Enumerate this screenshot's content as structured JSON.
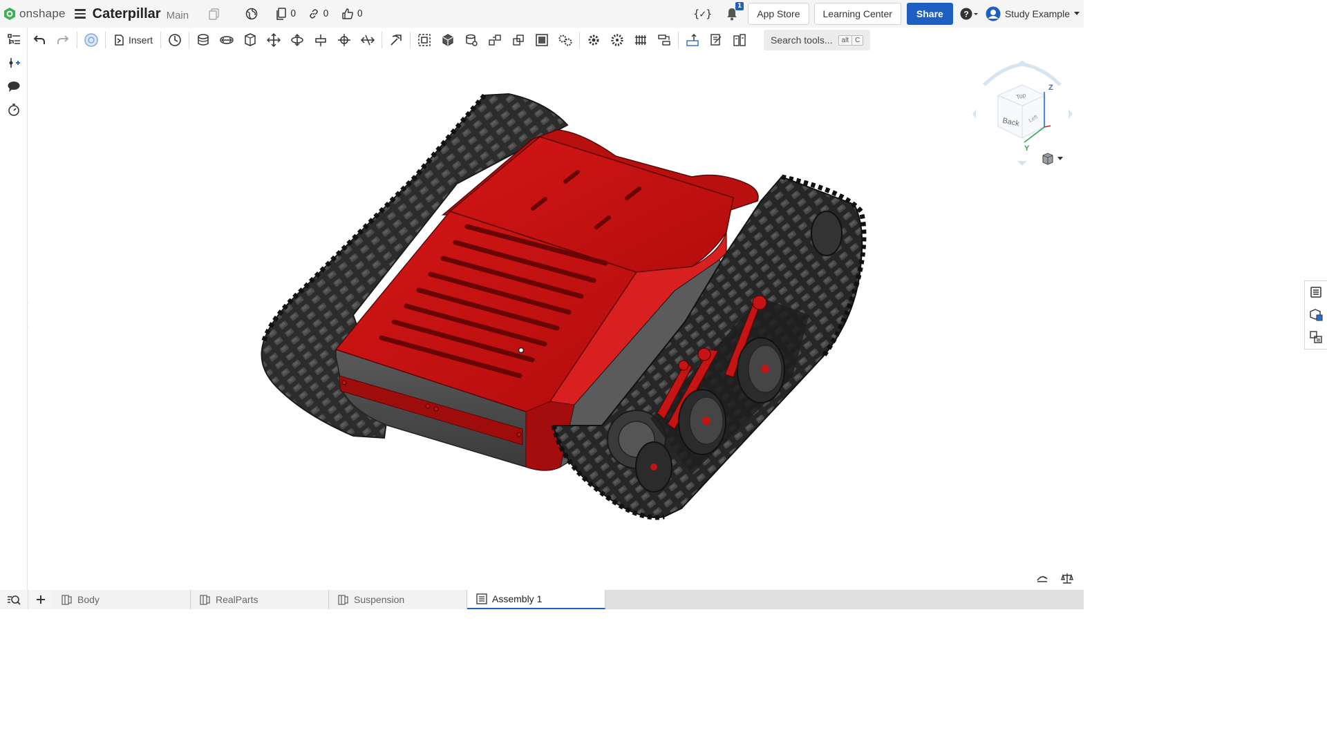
{
  "app": {
    "brand": "onshape",
    "accent": "#1f5fc2",
    "part_color": "#c41414"
  },
  "document": {
    "title": "Caterpillar",
    "branch": "Main"
  },
  "header": {
    "versions_count": "0",
    "links_count": "0",
    "likes_count": "0",
    "notifications_count": "1",
    "app_store_label": "App Store",
    "learning_center_label": "Learning Center",
    "share_label": "Share",
    "user_name": "Study Example"
  },
  "toolbar": {
    "insert_label": "Insert",
    "search_placeholder": "Search tools...",
    "search_shortcut": [
      "alt",
      "C"
    ]
  },
  "viewcube": {
    "faces": [
      "Top",
      "Back",
      "Left"
    ],
    "axes": [
      "Z",
      "Y"
    ]
  },
  "tabs": [
    {
      "label": "Body",
      "type": "part-studio",
      "active": false
    },
    {
      "label": "RealParts",
      "type": "part-studio",
      "active": false
    },
    {
      "label": "Suspension",
      "type": "part-studio",
      "active": false
    },
    {
      "label": "Assembly 1",
      "type": "assembly",
      "active": true
    }
  ]
}
